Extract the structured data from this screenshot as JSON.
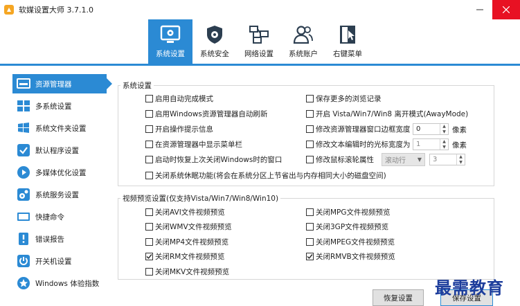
{
  "window": {
    "title": "软媒设置大师 3.7.1.0"
  },
  "tabs": [
    {
      "label": "系统设置",
      "icon": "monitor-gear-icon",
      "active": true
    },
    {
      "label": "系统安全",
      "icon": "shield-gear-icon",
      "active": false
    },
    {
      "label": "网络设置",
      "icon": "network-icon",
      "active": false
    },
    {
      "label": "系统账户",
      "icon": "users-icon",
      "active": false
    },
    {
      "label": "右键菜单",
      "icon": "cursor-menu-icon",
      "active": false
    }
  ],
  "sidebar": {
    "items": [
      {
        "label": "资源管理器",
        "icon": "explorer-icon",
        "active": true
      },
      {
        "label": "多系统设置",
        "icon": "multi-system-icon",
        "active": false
      },
      {
        "label": "系统文件夹设置",
        "icon": "windows-folder-icon",
        "active": false
      },
      {
        "label": "默认程序设置",
        "icon": "default-program-icon",
        "active": false
      },
      {
        "label": "多媒体优化设置",
        "icon": "media-icon",
        "active": false
      },
      {
        "label": "系统服务设置",
        "icon": "service-gear-icon",
        "active": false
      },
      {
        "label": "快捷命令",
        "icon": "command-icon",
        "active": false
      },
      {
        "label": "错误报告",
        "icon": "error-report-icon",
        "active": false
      },
      {
        "label": "开关机设置",
        "icon": "power-icon",
        "active": false
      },
      {
        "label": "Windows 体验指数",
        "icon": "star-icon",
        "active": false
      }
    ]
  },
  "system_group": {
    "title": "系统设置",
    "left_options": [
      {
        "label": "启用自动完成模式",
        "checked": false
      },
      {
        "label": "启用Windows资源管理器自动刷新",
        "checked": false
      },
      {
        "label": "开启操作提示信息",
        "checked": false
      },
      {
        "label": "在资源管理器中显示菜单栏",
        "checked": false
      },
      {
        "label": "启动时恢复上次关闭Windows时的窗口",
        "checked": false
      }
    ],
    "right_options": [
      {
        "label": "保存更多的浏览记录",
        "checked": false
      },
      {
        "label": "开启 Vista/Win7/Win8 离开模式(AwayMode)",
        "checked": false
      },
      {
        "label": "修改资源管理器窗口边框宽度",
        "checked": false
      },
      {
        "label": "修改文本编辑时的光标宽度为",
        "checked": false
      },
      {
        "label": "修改鼠标滚轮属性",
        "checked": false
      }
    ],
    "border_width_value": "0",
    "cursor_width_value": "1",
    "unit_label": "像素",
    "wheel_mode": "滚动行",
    "wheel_value": "3",
    "hibernate_option": {
      "label": "关闭系统休眠功能(将会在系统分区上节省出与内存相同大小的磁盘空间)",
      "checked": false
    }
  },
  "video_group": {
    "title": "视频预览设置(仅支持Vista/Win7/Win8/Win10)",
    "left_options": [
      {
        "label": "关闭AVI文件视频预览",
        "checked": false
      },
      {
        "label": "关闭WMV文件视频预览",
        "checked": false
      },
      {
        "label": "关闭MP4文件视频预览",
        "checked": false
      },
      {
        "label": "关闭RM文件视频预览",
        "checked": true
      },
      {
        "label": "关闭MKV文件视频预览",
        "checked": false
      }
    ],
    "right_options": [
      {
        "label": "关闭MPG文件视频预览",
        "checked": false
      },
      {
        "label": "关闭3GP文件视频预览",
        "checked": false
      },
      {
        "label": "关闭MPEG文件视频预览",
        "checked": false
      },
      {
        "label": "关闭RMVB文件视频预览",
        "checked": true
      }
    ]
  },
  "buttons": {
    "restore": "恢复设置",
    "save": "保存设置"
  },
  "watermark": "最需教育",
  "colors": {
    "accent": "#2b8ad4",
    "close": "#e81123"
  }
}
